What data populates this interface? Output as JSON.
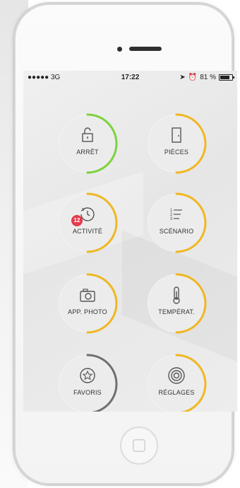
{
  "status_bar": {
    "carrier": "●●●●● 3G",
    "time": "17:22",
    "battery_text": "81 %"
  },
  "menu": [
    {
      "id": "arret",
      "label": "ARRÊT",
      "icon": "lock-open-icon",
      "ring_color": "#7bd33b",
      "ring_progress": 0.5
    },
    {
      "id": "pieces",
      "label": "PIÈCES",
      "icon": "door-icon",
      "ring_color": "#f0b723",
      "ring_progress": 0.5
    },
    {
      "id": "activite",
      "label": "ACTIVITÉ",
      "icon": "history-clock-icon",
      "ring_color": "#f0b723",
      "ring_progress": 0.5,
      "badge": "12",
      "badge_color": "#e43b4f"
    },
    {
      "id": "scenario",
      "label": "SCÉNARIO",
      "icon": "numbered-list-icon",
      "ring_color": "#f0b723",
      "ring_progress": 0.5
    },
    {
      "id": "app_photo",
      "label": "APP. PHOTO",
      "icon": "camera-icon",
      "ring_color": "#f0b723",
      "ring_progress": 0.5
    },
    {
      "id": "temperat",
      "label": "TEMPÉRAT.",
      "icon": "thermometer-icon",
      "ring_color": "#f0b723",
      "ring_progress": 0.5
    },
    {
      "id": "favoris",
      "label": "FAVORIS",
      "icon": "star-circle-icon",
      "ring_color": "#6f6f6f",
      "ring_progress": 0.5
    },
    {
      "id": "reglages",
      "label": "RÉGLAGES",
      "icon": "settings-target-icon",
      "ring_color": "#f0b723",
      "ring_progress": 0.5
    }
  ]
}
